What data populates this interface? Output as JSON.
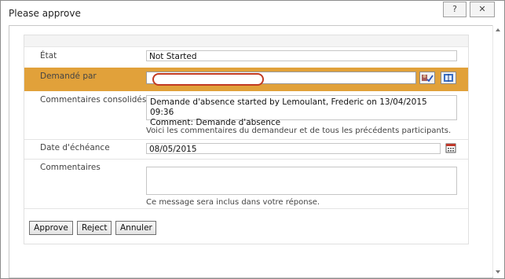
{
  "window": {
    "title": "Please approve",
    "help_glyph": "?",
    "close_glyph": "✕"
  },
  "form": {
    "etat": {
      "label": "État",
      "value": "Not Started"
    },
    "demande_par": {
      "label": "Demandé par",
      "value": ""
    },
    "commentaires_consolides": {
      "label": "Commentaires consolidés",
      "line1": "Demande d'absence started by Lemoulant, Frederic on 13/04/2015 09:36",
      "line2": "Comment: Demande d'absence",
      "hint": "Voici les commentaires du demandeur et de tous les précédents participants."
    },
    "date_echeance": {
      "label": "Date d'échéance",
      "value": "08/05/2015"
    },
    "commentaires": {
      "label": "Commentaires",
      "value": "",
      "hint": "Ce message sera inclus dans votre réponse."
    }
  },
  "buttons": {
    "approve": "Approve",
    "reject": "Reject",
    "annuler": "Annuler"
  },
  "colors": {
    "highlight_row": "#e1a13a",
    "redaction_outline": "#c23b22"
  },
  "icons": {
    "check_names": "check-names-icon",
    "browse_people": "address-book-icon",
    "calendar": "calendar-icon"
  }
}
